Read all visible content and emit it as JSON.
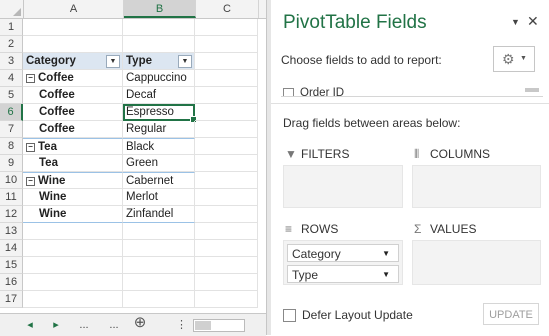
{
  "sheet": {
    "columns": [
      "A",
      "B",
      "C"
    ],
    "selected_column": "B",
    "selected_row": "6",
    "rows": [
      {
        "num": "1",
        "a": "",
        "b": ""
      },
      {
        "num": "2",
        "a": "",
        "b": ""
      },
      {
        "num": "3",
        "a": "Category",
        "b": "Type"
      },
      {
        "num": "4",
        "a": "Coffee",
        "b": "Cappuccino"
      },
      {
        "num": "5",
        "a": "Coffee",
        "b": "Decaf"
      },
      {
        "num": "6",
        "a": "Coffee",
        "b": "Espresso"
      },
      {
        "num": "7",
        "a": "Coffee",
        "b": "Regular"
      },
      {
        "num": "8",
        "a": "Tea",
        "b": "Black"
      },
      {
        "num": "9",
        "a": "Tea",
        "b": "Green"
      },
      {
        "num": "10",
        "a": "Wine",
        "b": "Cabernet"
      },
      {
        "num": "11",
        "a": "Wine",
        "b": "Merlot"
      },
      {
        "num": "12",
        "a": "Wine",
        "b": "Zinfandel"
      },
      {
        "num": "13",
        "a": "",
        "b": ""
      },
      {
        "num": "14",
        "a": "",
        "b": ""
      },
      {
        "num": "15",
        "a": "",
        "b": ""
      },
      {
        "num": "16",
        "a": "",
        "b": ""
      },
      {
        "num": "17",
        "a": "",
        "b": ""
      }
    ],
    "tabbar": {
      "prev": "◂",
      "next": "▸",
      "ellipsis_left": "...",
      "ellipsis_right": "...",
      "add": "⊕",
      "more": "⋮"
    }
  },
  "panel": {
    "title": "PivotTable Fields",
    "choose_label": "Choose fields to add to report:",
    "field_partial": "Order ID",
    "drag_label": "Drag fields between areas below:",
    "areas": {
      "filters": "FILTERS",
      "columns": "COLUMNS",
      "rows": "ROWS",
      "values": "VALUES"
    },
    "row_fields": [
      "Category",
      "Type"
    ],
    "defer_label": "Defer Layout Update",
    "update_label": "UPDATE"
  },
  "colors": {
    "accent": "#217346",
    "header_fill": "#dce6f1"
  }
}
